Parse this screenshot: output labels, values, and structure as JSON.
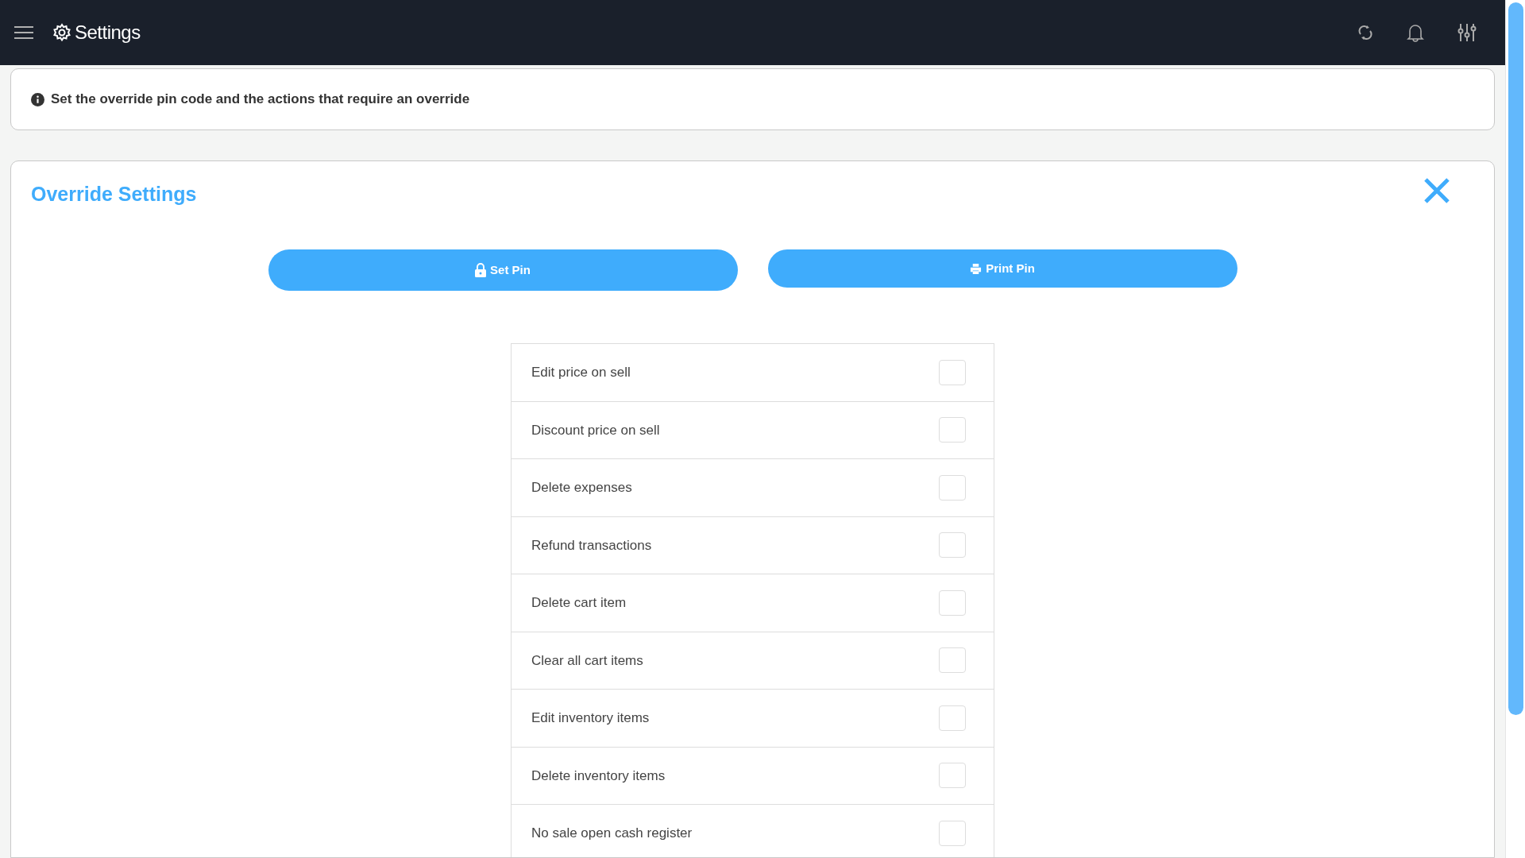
{
  "header": {
    "title": "Settings"
  },
  "info": {
    "text": "Set the override pin code and the actions that require an override"
  },
  "panel": {
    "title": "Override Settings"
  },
  "buttons": [
    {
      "label": "Set Pin",
      "kind": "lock"
    },
    {
      "label": "Print Pin",
      "kind": "print"
    }
  ],
  "options": [
    {
      "label": "Edit price on sell",
      "checked": false
    },
    {
      "label": "Discount price on sell",
      "checked": false
    },
    {
      "label": "Delete expenses",
      "checked": false
    },
    {
      "label": "Refund transactions",
      "checked": false
    },
    {
      "label": "Delete cart item",
      "checked": false
    },
    {
      "label": "Clear all cart items",
      "checked": false
    },
    {
      "label": "Edit inventory items",
      "checked": false
    },
    {
      "label": "Delete inventory items",
      "checked": false
    },
    {
      "label": "No sale open cash register",
      "checked": false
    }
  ]
}
